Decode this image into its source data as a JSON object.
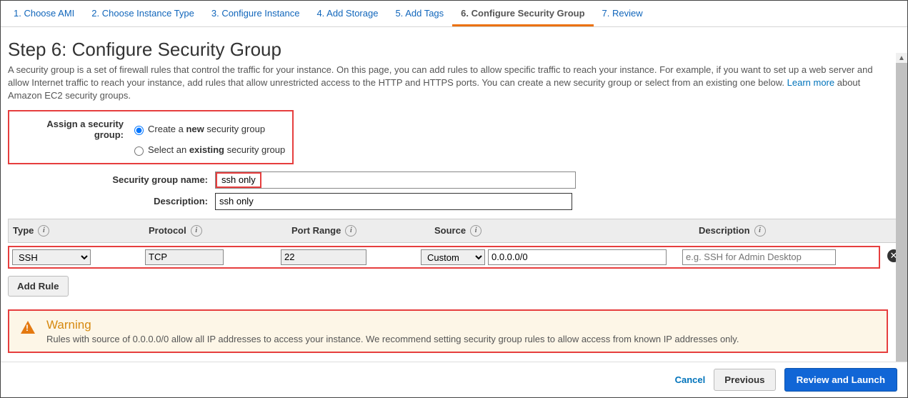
{
  "tabs": [
    {
      "label": "1. Choose AMI"
    },
    {
      "label": "2. Choose Instance Type"
    },
    {
      "label": "3. Configure Instance"
    },
    {
      "label": "4. Add Storage"
    },
    {
      "label": "5. Add Tags"
    },
    {
      "label": "6. Configure Security Group"
    },
    {
      "label": "7. Review"
    }
  ],
  "active_tab_index": 5,
  "heading": "Step 6: Configure Security Group",
  "description_pre": "A security group is a set of firewall rules that control the traffic for your instance. On this page, you can add rules to allow specific traffic to reach your instance. For example, if you want to set up a web server and allow Internet traffic to reach your instance, add rules that allow unrestricted access to the HTTP and HTTPS ports. You can create a new security group or select from an existing one below. ",
  "learn_more": "Learn more",
  "description_post": " about Amazon EC2 security groups.",
  "assign_label": "Assign a security group:",
  "radio_create_pre": "Create a ",
  "radio_create_bold": "new",
  "radio_create_post": " security group",
  "radio_select_pre": "Select an ",
  "radio_select_bold": "existing",
  "radio_select_post": " security group",
  "radio_selected": "create",
  "name_label": "Security group name:",
  "name_value": "ssh only",
  "desc_label": "Description:",
  "desc_value": "ssh only",
  "columns": {
    "type": "Type",
    "protocol": "Protocol",
    "port": "Port Range",
    "source": "Source",
    "description": "Description"
  },
  "rule": {
    "type": "SSH",
    "protocol": "TCP",
    "port": "22",
    "source_mode": "Custom",
    "source_value": "0.0.0.0/0",
    "description_placeholder": "e.g. SSH for Admin Desktop"
  },
  "add_rule": "Add Rule",
  "warning": {
    "title": "Warning",
    "text": "Rules with source of 0.0.0.0/0 allow all IP addresses to access your instance. We recommend setting security group rules to allow access from known IP addresses only."
  },
  "footer": {
    "cancel": "Cancel",
    "previous": "Previous",
    "review": "Review and Launch"
  }
}
